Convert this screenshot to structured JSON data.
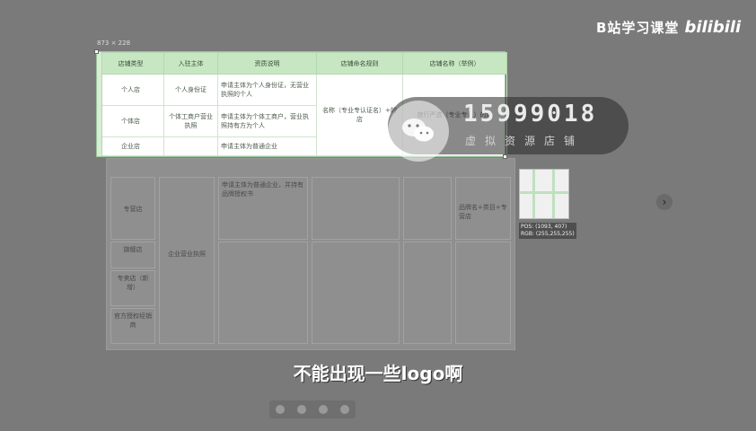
{
  "brand": {
    "text": "B站学习课堂",
    "logo": "bilibili"
  },
  "snip": {
    "size_label": "873 × 228",
    "headers": [
      "店铺类型",
      "入驻主体",
      "资质说明",
      "店铺命名规则",
      "店铺名称（举例）"
    ],
    "rows": [
      {
        "type": "个人店",
        "subject": "个人身份证",
        "desc": "申请主体为个人身份证，无营业执照的个人"
      },
      {
        "type": "个体店",
        "subject": "个体工商户营业执照",
        "desc": "申请主体为个体工商户，营业执照持有方为个人",
        "rule": "名称（专业专认证名）+的店",
        "example": "旅行严选（专业专认）的店"
      },
      {
        "type": "企业店",
        "subject": "",
        "desc": "申请主体为普通企业"
      }
    ]
  },
  "bg_doc": {
    "cells": [
      "专营店",
      "旗舰店",
      "专卖店（新增）",
      "官方授权经销商",
      "企业营业执照",
      "申请主体为普通企业，并持有品牌授权书",
      "品牌名+类目+专营店"
    ]
  },
  "watermark": {
    "number": "15999018",
    "sub": "虚拟资源店铺"
  },
  "picker": {
    "pos": "POS: (1093, 407)",
    "rgb": "RGB: (255,255,255)"
  },
  "subtitle": "不能出现一些logo啊",
  "colors": {
    "header_green": "#c7e7c2",
    "page_bg": "#7a7a7a"
  }
}
